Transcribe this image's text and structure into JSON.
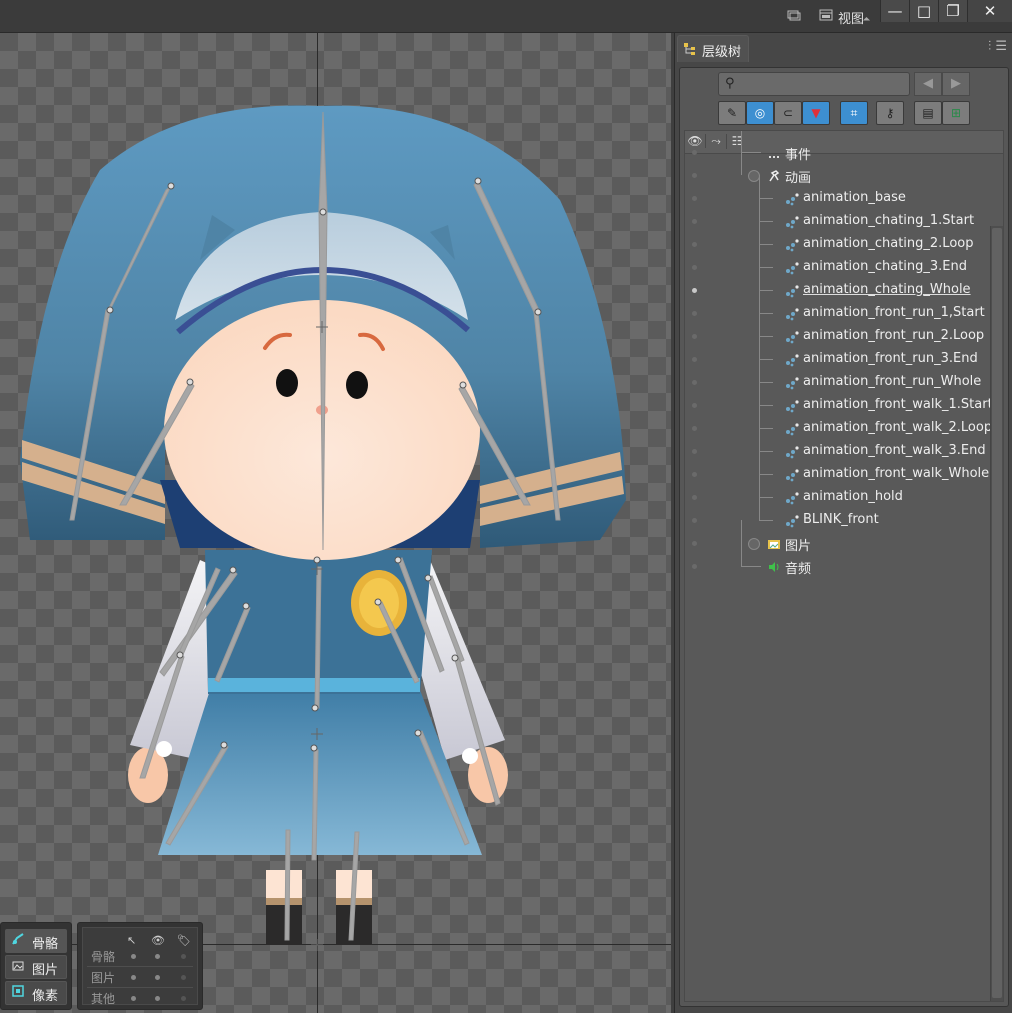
{
  "toolbar": {
    "view_label": "视图",
    "icons": [
      "layers-icon",
      "view-icon",
      "minimize-icon",
      "maximize-icon",
      "restore-icon",
      "close-icon"
    ]
  },
  "left_controls": {
    "buttons": [
      {
        "label": "骨骼",
        "icon": "bone-icon",
        "active": true
      },
      {
        "label": "图片",
        "icon": "image-icon",
        "active": false
      },
      {
        "label": "像素",
        "icon": "pixel-icon",
        "active": false
      }
    ],
    "visibility_rows": [
      "骨骼",
      "图片",
      "其他"
    ],
    "visibility_headers": [
      "select-icon",
      "eye-icon",
      "tag-icon"
    ]
  },
  "panel": {
    "tab_label": "层级树",
    "search_placeholder": "",
    "tool_buttons": [
      "brush-icon",
      "circle-icon",
      "link-icon",
      "filter-icon",
      "focus-icon",
      "key-icon",
      "layer-icon",
      "add-layer-icon"
    ],
    "columns": [
      "eye-icon",
      "bone-link-icon",
      "hierarchy-icon"
    ],
    "tree": [
      {
        "label": "事件",
        "depth": 1,
        "type": "event",
        "eye": false
      },
      {
        "label": "动画",
        "depth": 1,
        "type": "folder-animation",
        "eye": false
      },
      {
        "label": "animation_base",
        "depth": 2,
        "type": "animation",
        "eye": false
      },
      {
        "label": "animation_chating_1.Start",
        "depth": 2,
        "type": "animation",
        "eye": false
      },
      {
        "label": "animation_chating_2.Loop",
        "depth": 2,
        "type": "animation",
        "eye": false
      },
      {
        "label": "animation_chating_3.End",
        "depth": 2,
        "type": "animation",
        "eye": false
      },
      {
        "label": "animation_chating_Whole",
        "depth": 2,
        "type": "animation",
        "eye": true,
        "selected": true
      },
      {
        "label": "animation_front_run_1,Start",
        "depth": 2,
        "type": "animation",
        "eye": false
      },
      {
        "label": "animation_front_run_2.Loop",
        "depth": 2,
        "type": "animation",
        "eye": false
      },
      {
        "label": "animation_front_run_3.End",
        "depth": 2,
        "type": "animation",
        "eye": false
      },
      {
        "label": "animation_front_run_Whole",
        "depth": 2,
        "type": "animation",
        "eye": false
      },
      {
        "label": "animation_front_walk_1.Start",
        "depth": 2,
        "type": "animation",
        "eye": false
      },
      {
        "label": "animation_front_walk_2.Loop",
        "depth": 2,
        "type": "animation",
        "eye": false
      },
      {
        "label": "animation_front_walk_3.End",
        "depth": 2,
        "type": "animation",
        "eye": false
      },
      {
        "label": "animation_front_walk_Whole",
        "depth": 2,
        "type": "animation",
        "eye": false
      },
      {
        "label": "animation_hold",
        "depth": 2,
        "type": "animation",
        "eye": false
      },
      {
        "label": "BLINK_front",
        "depth": 2,
        "type": "animation",
        "eye": false
      },
      {
        "label": "图片",
        "depth": 1,
        "type": "folder-image",
        "eye": false
      },
      {
        "label": "音频",
        "depth": 1,
        "type": "audio",
        "eye": false
      }
    ]
  },
  "colors": {
    "accent": "#3d8fd1",
    "hair": "#5b93b8",
    "skin": "#fde4d3",
    "dress": "#4a86ad"
  }
}
